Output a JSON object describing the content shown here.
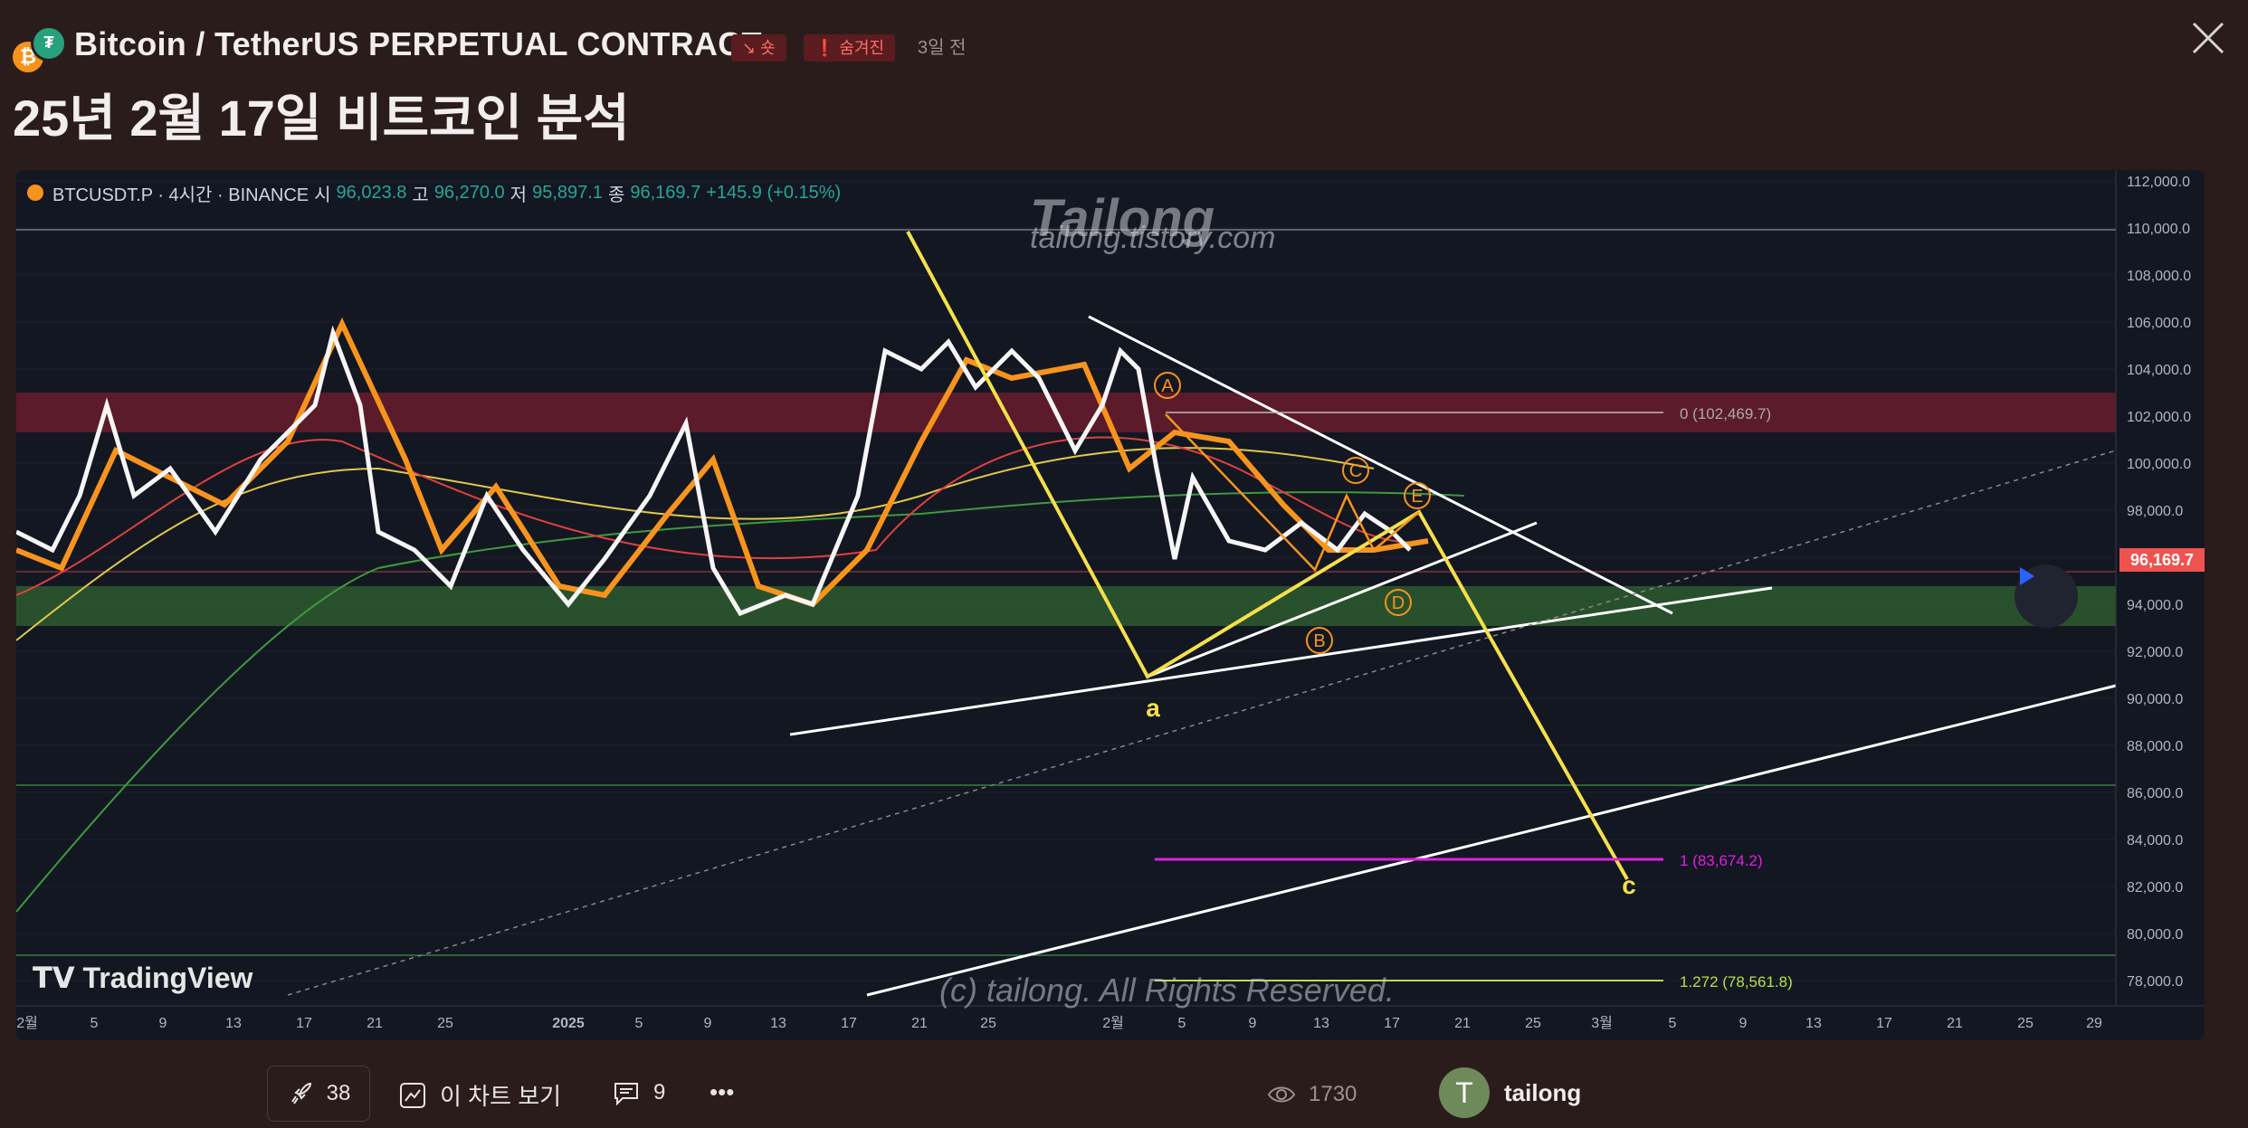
{
  "header": {
    "symbol_title": "Bitcoin / TetherUS PERPETUAL CONTRACT",
    "badge_short": "↘ 숏",
    "badge_hidden": "❗ 숨겨진",
    "time_ago": "3일 전",
    "idea_title": "25년 2월 17일 비트코인 분석",
    "logo_btc": "₿",
    "logo_usdt": "₮"
  },
  "chart": {
    "legend": {
      "symbol": "BTCUSDT.P · 4시간 · BINANCE",
      "open_label": "시",
      "open": "96,023.8",
      "high_label": "고",
      "high": "96,270.0",
      "low_label": "저",
      "low": "95,897.1",
      "close_label": "종",
      "close": "96,169.7",
      "change": "+145.9 (+0.15%)"
    },
    "watermark_top": "Tailong",
    "watermark_url": "tailong.tistory.com",
    "watermark_bottom": "(c) tailong. All Rights Reserved.",
    "tv_brand": "TradingView",
    "current_price": "96,169.7",
    "price_axis": [
      "112,000.0",
      "110,000.0",
      "108,000.0",
      "106,000.0",
      "104,000.0",
      "102,000.0",
      "100,000.0",
      "98,000.0",
      "94,000.0",
      "92,000.0",
      "90,000.0",
      "88,000.0",
      "86,000.0",
      "84,000.0",
      "82,000.0",
      "80,000.0",
      "78,000.0"
    ],
    "time_axis": [
      "2월",
      "5",
      "9",
      "13",
      "17",
      "21",
      "25",
      "2025",
      "5",
      "9",
      "13",
      "17",
      "21",
      "25",
      "2월",
      "5",
      "9",
      "13",
      "17",
      "21",
      "25",
      "3월",
      "5",
      "9",
      "13",
      "17",
      "21",
      "25",
      "29"
    ],
    "fib_labels": [
      "0 (102,469.7)",
      "1 (83,674.2)",
      "1.272 (78,561.8)"
    ],
    "wave_labels": {
      "a": "a",
      "c": "c",
      "A": "A",
      "B": "B",
      "C": "C",
      "D": "D",
      "E": "E"
    },
    "colors": {
      "background": "#131722",
      "up_zone": "#6a1c2c",
      "down_zone": "#2e5a2e",
      "wave": "#f5e04a",
      "orange": "#f7941d",
      "fib_magenta": "#e020e0",
      "fib_green": "#b6e04a"
    }
  },
  "footer": {
    "boost_count": "38",
    "view_chart_label": "이 차트 보기",
    "comment_count": "9",
    "more_label": "•••",
    "views_count": "1730",
    "author_initial": "T",
    "author_name": "tailong"
  }
}
